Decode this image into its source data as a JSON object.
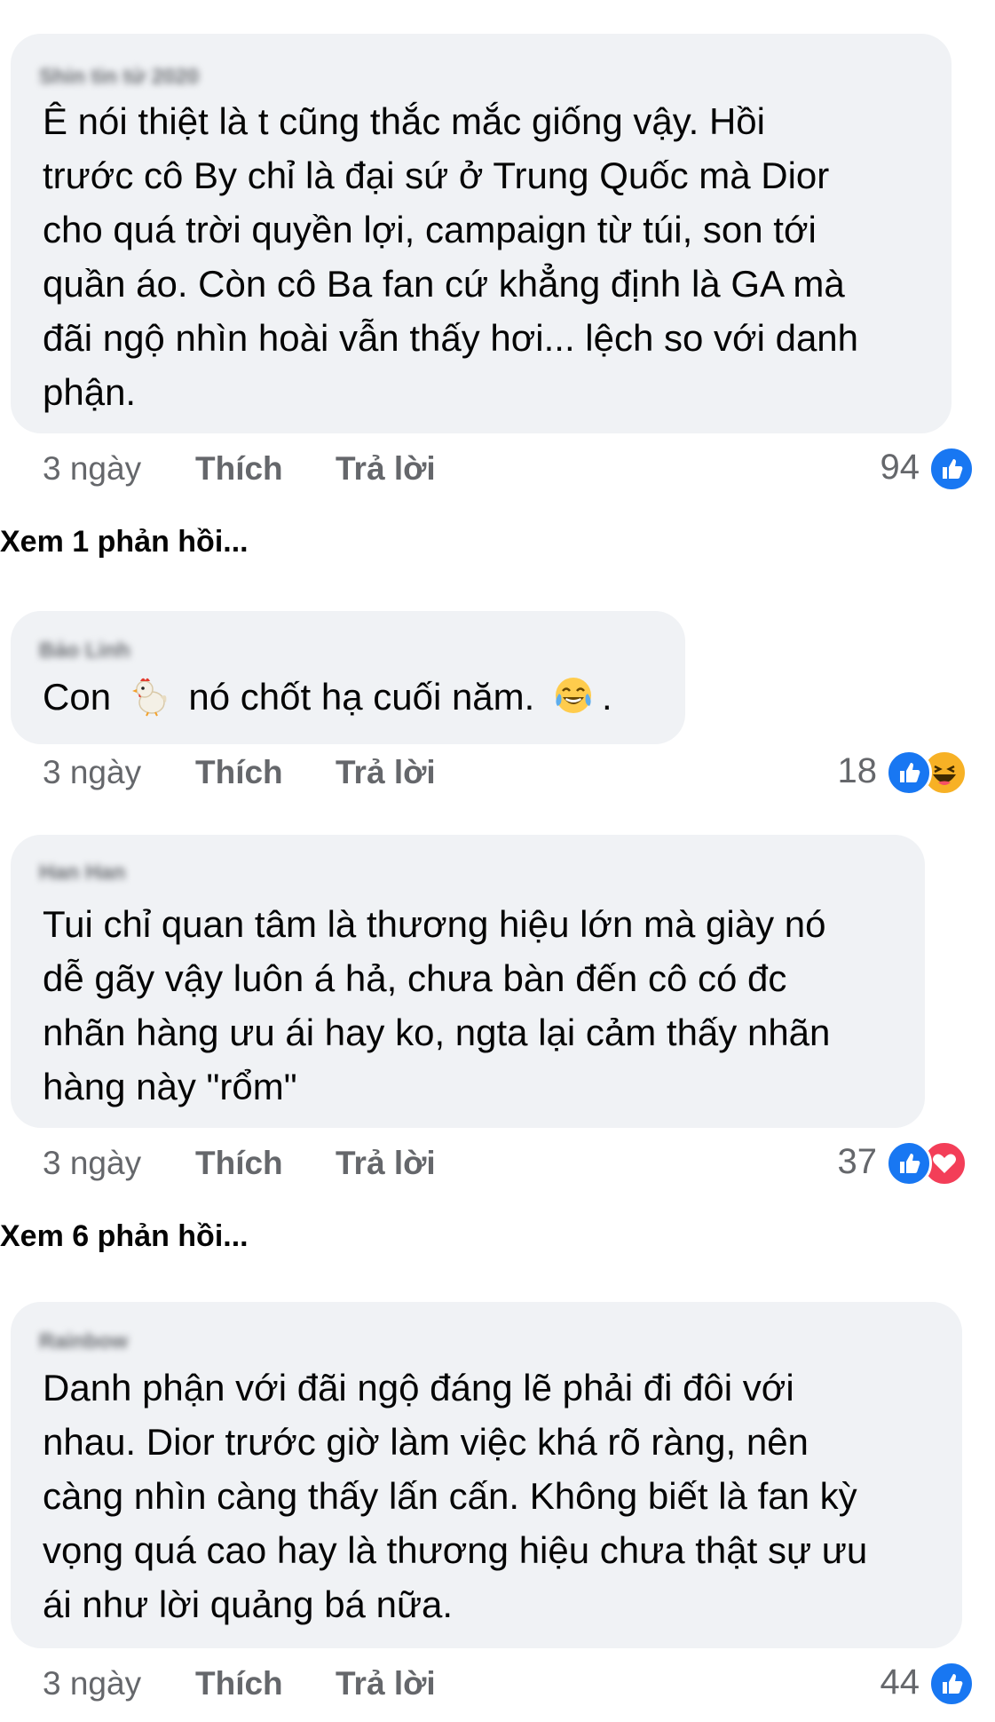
{
  "comments": [
    {
      "author": "Shin tin tử 2020",
      "lines": [
        "Ê nói thiệt là t cũng thắc mắc giống vậy. Hồi",
        "trước cô By chỉ là đại sứ ở Trung Quốc mà Dior",
        "cho quá trời quyền lợi, campaign từ túi, son tới",
        "quần áo. Còn cô Ba fan cứ khẳng định là GA mà",
        "đãi ngộ nhìn hoài vẫn thấy hơi... lệch so với danh",
        "phận."
      ],
      "time": "3 ngày",
      "like_label": "Thích",
      "reply_label": "Trả lời",
      "reaction_count": "94",
      "reactions": [
        "like-icon"
      ]
    },
    {
      "author": "Bảo Linh",
      "text_before": "Con",
      "text_after": "nó chốt hạ cuối năm.",
      "text_end": ".",
      "time": "3 ngày",
      "like_label": "Thích",
      "reply_label": "Trả lời",
      "reaction_count": "18",
      "reactions": [
        "like-icon",
        "haha-icon"
      ]
    },
    {
      "author": "Han Han",
      "lines": [
        "Tui chỉ quan tâm là thương hiệu lớn mà giày nó",
        "dễ gãy vậy luôn á hả, chưa bàn đến cô có đc",
        "nhãn hàng ưu ái hay ko, ngta lại cảm thấy nhãn",
        "hàng này \"rổm\""
      ],
      "time": "3 ngày",
      "like_label": "Thích",
      "reply_label": "Trả lời",
      "reaction_count": "37",
      "reactions": [
        "like-icon",
        "love-icon"
      ]
    },
    {
      "author": "Rainbow",
      "lines": [
        "Danh phận với đãi ngộ đáng lẽ phải đi đôi với",
        "nhau. Dior trước giờ làm việc khá rõ ràng, nên",
        "càng nhìn càng thấy lấn cấn. Không biết là fan kỳ",
        "vọng quá cao hay là thương hiệu chưa thật sự ưu",
        "ái như lời quảng bá nữa."
      ],
      "time": "3 ngày",
      "like_label": "Thích",
      "reply_label": "Trả lời",
      "reaction_count": "44",
      "reactions": [
        "like-icon"
      ]
    }
  ],
  "view_replies": [
    "Xem 1 phản hồi...",
    "Xem 6 phản hồi..."
  ],
  "colors": {
    "bubble_bg": "#f0f2f5",
    "like_blue": "#1877f2",
    "love_red": "#f33e58",
    "haha_yellow": "#f7b125",
    "meta_gray": "#65676b"
  },
  "inline_emojis": [
    "chicken-emoji",
    "tears-of-joy-emoji"
  ]
}
